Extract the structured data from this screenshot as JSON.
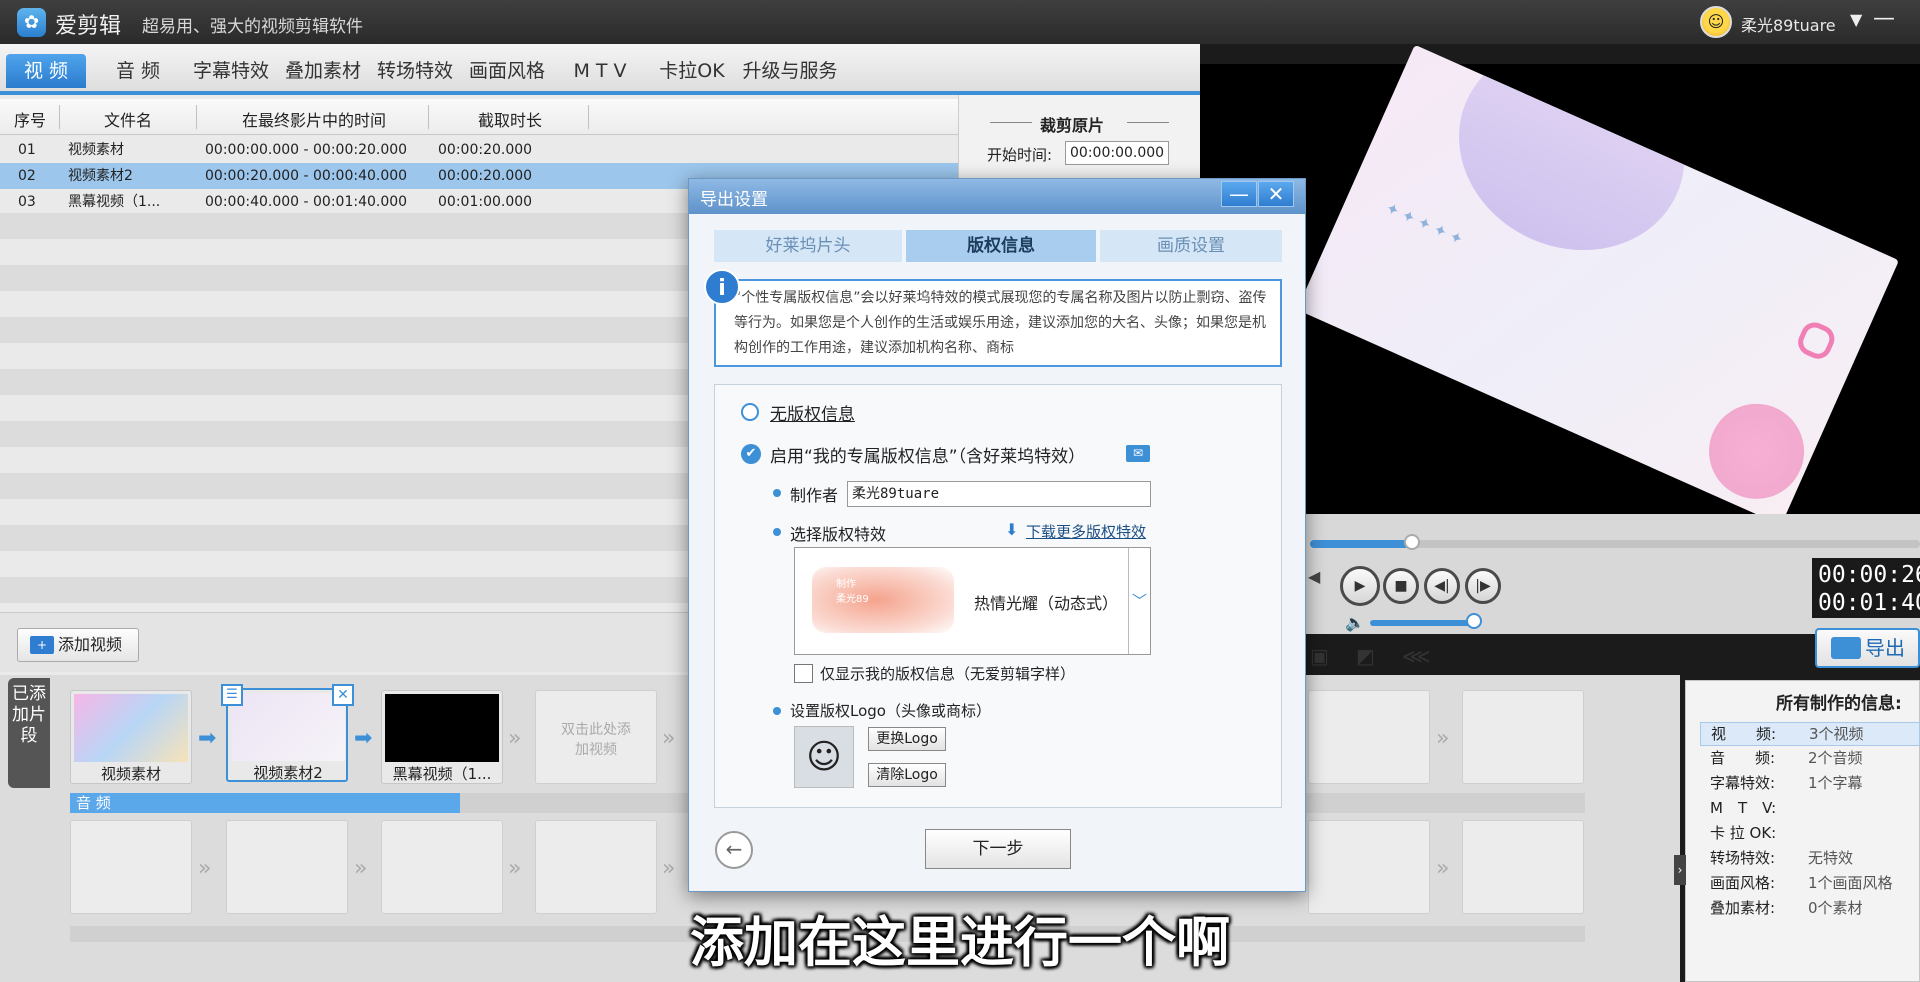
{
  "app": {
    "logo_glyph": "✿",
    "name": "爱剪辑",
    "slogan": "超易用、强大的视频剪辑软件",
    "username": "柔光89tuare",
    "user_caret": "▼",
    "minimize": "—"
  },
  "tabs": [
    {
      "label": "视 频",
      "active": true
    },
    {
      "label": "音 频"
    },
    {
      "label": "字幕特效"
    },
    {
      "label": "叠加素材"
    },
    {
      "label": "转场特效"
    },
    {
      "label": "画面风格"
    },
    {
      "label": "M T V"
    },
    {
      "label": "卡拉OK"
    },
    {
      "label": "升级与服务"
    }
  ],
  "table": {
    "headers": [
      "序号",
      "文件名",
      "在最终影片中的时间",
      "截取时长"
    ],
    "rows": [
      {
        "no": "01",
        "name": "视频素材",
        "range": "00:00:00.000 - 00:00:20.000",
        "dur": "00:00:20.000"
      },
      {
        "no": "02",
        "name": "视频素材2",
        "range": "00:00:20.000 - 00:00:40.000",
        "dur": "00:00:20.000",
        "selected": true
      },
      {
        "no": "03",
        "name": "黑幕视频（1...",
        "range": "00:00:40.000 - 00:01:40.000",
        "dur": "00:01:00.000"
      }
    ]
  },
  "crop": {
    "title": "裁剪原片",
    "start_label": "开始时间:",
    "start_value": "00:00:00.000"
  },
  "add_video_label": "添加视频",
  "timeline": {
    "side_label": "已添加片段",
    "clips": [
      {
        "caption": "视频素材"
      },
      {
        "caption": "视频素材2"
      },
      {
        "caption": "黑幕视频（1..."
      }
    ],
    "empty_hint": "双击此处添加视频",
    "audio_label": "音 频"
  },
  "player": {
    "time_current": "00:00:26",
    "time_total": "00:01:40",
    "export_label": "导出"
  },
  "info": {
    "title": "所有制作的信息:",
    "rows": [
      {
        "k": "视　　频:",
        "v": "3个视频"
      },
      {
        "k": "音　　频:",
        "v": "2个音频"
      },
      {
        "k": "字幕特效:",
        "v": "1个字幕"
      },
      {
        "k": "M　T　V:",
        "v": ""
      },
      {
        "k": "卡 拉 OK:",
        "v": ""
      },
      {
        "k": "转场特效:",
        "v": "无特效"
      },
      {
        "k": "画面风格:",
        "v": "1个画面风格"
      },
      {
        "k": "叠加素材:",
        "v": "0个素材"
      }
    ]
  },
  "dialog": {
    "title": "导出设置",
    "steps": [
      "好莱坞片头",
      "版权信息",
      "画质设置"
    ],
    "notice": "“个性专属版权信息”会以好莱坞特效的模式展现您的专属名称及图片以防止剽窃、盗传等行为。如果您是个人创作的生活或娱乐用途，建议添加您的大名、头像；如果您是机构创作的工作用途，建议添加机构名称、商标",
    "opt_none": "无版权信息",
    "opt_enable": "启用“我的专属版权信息”（含好莱坞特效）",
    "maker_label": "制作者",
    "maker_value": "柔光89tuare",
    "effect_label": "选择版权特效",
    "download_label": "下载更多版权特效",
    "effect_name": "热情光耀（动态式）",
    "effect_thumb_text": "制作\n柔光89",
    "only_mine_label": "仅显示我的版权信息（无爱剪辑字样）",
    "logo_label": "设置版权Logo（头像或商标）",
    "change_logo": "更换Logo",
    "clear_logo": "清除Logo",
    "next_label": "下一步"
  },
  "subtitle": "添加在这里进行一个啊"
}
